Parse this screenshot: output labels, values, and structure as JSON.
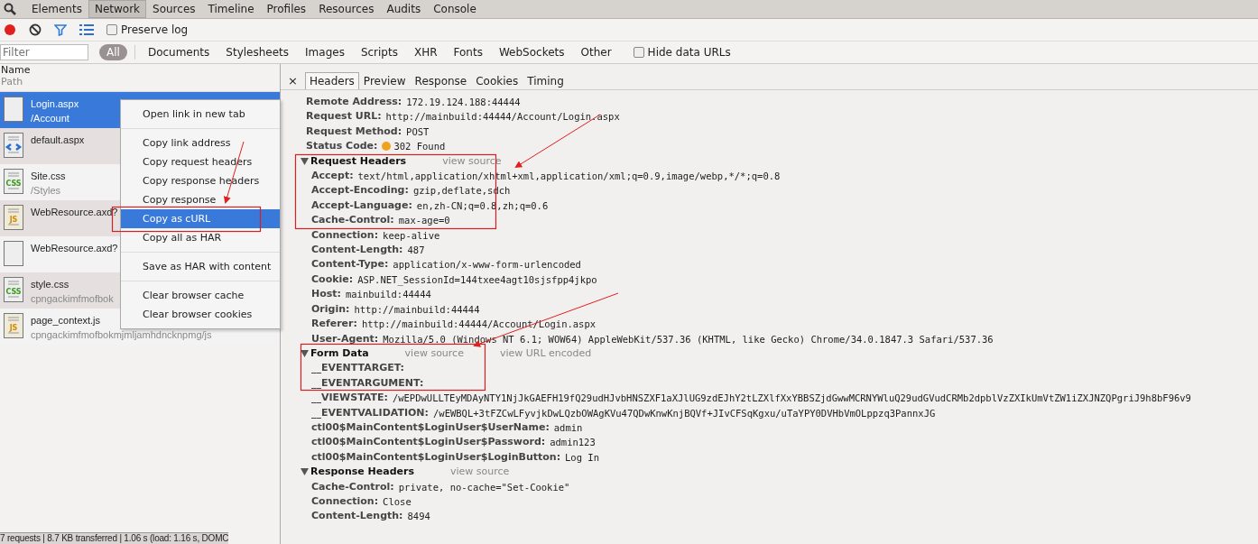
{
  "panel_tabs": [
    {
      "label": "Elements",
      "selected": false
    },
    {
      "label": "Network",
      "selected": true
    },
    {
      "label": "Sources",
      "selected": false
    },
    {
      "label": "Timeline",
      "selected": false
    },
    {
      "label": "Profiles",
      "selected": false
    },
    {
      "label": "Resources",
      "selected": false
    },
    {
      "label": "Audits",
      "selected": false
    },
    {
      "label": "Console",
      "selected": false
    }
  ],
  "toolbar": {
    "recording": true,
    "preserve_log": {
      "label": "Preserve log",
      "checked": false
    }
  },
  "filter_bar": {
    "placeholder": "Filter",
    "types": [
      {
        "label": "All",
        "selected": true
      },
      {
        "label": "Documents",
        "selected": false
      },
      {
        "label": "Stylesheets",
        "selected": false
      },
      {
        "label": "Images",
        "selected": false
      },
      {
        "label": "Scripts",
        "selected": false
      },
      {
        "label": "XHR",
        "selected": false
      },
      {
        "label": "Fonts",
        "selected": false
      },
      {
        "label": "WebSockets",
        "selected": false
      },
      {
        "label": "Other",
        "selected": false
      }
    ],
    "hide_data_urls": {
      "label": "Hide data URLs",
      "checked": false
    }
  },
  "request_list": {
    "columns": [
      "Name",
      "Path"
    ],
    "rows": [
      {
        "kind": "blank",
        "name": "Login.aspx",
        "path": "/Account",
        "selected": true
      },
      {
        "kind": "html",
        "name": "default.aspx",
        "selected": false
      },
      {
        "kind": "css",
        "icon_text": "CSS",
        "name": "Site.css",
        "path": "/Styles",
        "selected": false
      },
      {
        "kind": "js",
        "icon_text": "JS",
        "name": "WebResource.axd?",
        "selected": false
      },
      {
        "kind": "blank",
        "name": "WebResource.axd?",
        "selected": false
      },
      {
        "kind": "css",
        "icon_text": "CSS",
        "name": "style.css",
        "path": "cpngackimfmofbok",
        "selected": false
      },
      {
        "kind": "js",
        "icon_text": "JS",
        "name": "page_context.js",
        "path": "cpngackimfmofbokmjmljamhdncknpmg/js",
        "selected": false
      }
    ],
    "status_bar": "7 requests | 8.7 KB transferred | 1.06 s (load: 1.16 s, DOMC"
  },
  "context_menu": {
    "groups": [
      {
        "items": [
          {
            "label": "Open link in new tab",
            "selected": false
          }
        ]
      },
      {
        "items": [
          {
            "label": "Copy link address",
            "selected": false
          },
          {
            "label": "Copy request headers",
            "selected": false
          },
          {
            "label": "Copy response headers",
            "selected": false
          },
          {
            "label": "Copy response",
            "selected": false
          },
          {
            "label": "Copy as cURL",
            "selected": true
          },
          {
            "label": "Copy all as HAR",
            "selected": false
          }
        ]
      },
      {
        "items": [
          {
            "label": "Save as HAR with content",
            "selected": false
          }
        ]
      },
      {
        "items": [
          {
            "label": "Clear browser cache",
            "selected": false
          },
          {
            "label": "Clear browser cookies",
            "selected": false
          }
        ]
      }
    ]
  },
  "details": {
    "close": "×",
    "tabs": [
      {
        "label": "Headers",
        "selected": true
      },
      {
        "label": "Preview",
        "selected": false
      },
      {
        "label": "Response",
        "selected": false
      },
      {
        "label": "Cookies",
        "selected": false
      },
      {
        "label": "Timing",
        "selected": false
      }
    ],
    "general": [
      {
        "name": "Remote Address:",
        "value": "172.19.124.188:44444"
      },
      {
        "name": "Request URL:",
        "value": "http://mainbuild:44444/Account/Login.aspx"
      },
      {
        "name": "Request Method:",
        "value": "POST"
      },
      {
        "name": "Status Code:",
        "value": "302 Found",
        "color": "#f0a21e"
      }
    ],
    "sections": [
      {
        "title": "Request Headers",
        "expanded": true,
        "links": [
          "view source"
        ],
        "items": [
          {
            "name": "Accept:",
            "value": "text/html,application/xhtml+xml,application/xml;q=0.9,image/webp,*/*;q=0.8"
          },
          {
            "name": "Accept-Encoding:",
            "value": "gzip,deflate,sdch"
          },
          {
            "name": "Accept-Language:",
            "value": "en,zh-CN;q=0.8,zh;q=0.6"
          },
          {
            "name": "Cache-Control:",
            "value": "max-age=0"
          },
          {
            "name": "Connection:",
            "value": "keep-alive"
          },
          {
            "name": "Content-Length:",
            "value": "487"
          },
          {
            "name": "Content-Type:",
            "value": "application/x-www-form-urlencoded"
          },
          {
            "name": "Cookie:",
            "value": "ASP.NET_SessionId=144txee4agt10sjsfpp4jkpo"
          },
          {
            "name": "Host:",
            "value": "mainbuild:44444"
          },
          {
            "name": "Origin:",
            "value": "http://mainbuild:44444"
          },
          {
            "name": "Referer:",
            "value": "http://mainbuild:44444/Account/Login.aspx"
          },
          {
            "name": "User-Agent:",
            "value": "Mozilla/5.0 (Windows NT 6.1; WOW64) AppleWebKit/537.36 (KHTML, like Gecko) Chrome/34.0.1847.3 Safari/537.36"
          }
        ]
      },
      {
        "title": "Form Data",
        "expanded": true,
        "links": [
          "view source",
          "view URL encoded"
        ],
        "items": [
          {
            "name": "__EVENTTARGET:",
            "value": ""
          },
          {
            "name": "__EVENTARGUMENT:",
            "value": ""
          },
          {
            "name": "__VIEWSTATE:",
            "value": "/wEPDwULLTEyMDAyNTY1NjJkGAEFH19fQ29udHJvbHNSZXF1aXJlUG9zdEJhY2tLZXlfXxYBBSZjdGwwMCRNYWluQ29udGVudCRMb2dpblVzZXIkUmVtZW1iZXJNZQPgriJ9h8bF96v9"
          },
          {
            "name": "__EVENTVALIDATION:",
            "value": "/wEWBQL+3tFZCwLFyvjkDwLQzbOWAgKVu47QDwKnwKnjBQVf+JIvCFSqKgxu/uTaYPY0DVHbVmOLppzq3PannxJG"
          },
          {
            "name": "ctl00$MainContent$LoginUser$UserName:",
            "value": "admin"
          },
          {
            "name": "ctl00$MainContent$LoginUser$Password:",
            "value": "admin123"
          },
          {
            "name": "ctl00$MainContent$LoginUser$LoginButton:",
            "value": "Log In"
          }
        ]
      },
      {
        "title": "Response Headers",
        "expanded": true,
        "links": [
          "view source"
        ],
        "items": [
          {
            "name": "Cache-Control:",
            "value": "private, no-cache=\"Set-Cookie\""
          },
          {
            "name": "Connection:",
            "value": "Close"
          },
          {
            "name": "Content-Length:",
            "value": "8494"
          }
        ]
      }
    ]
  }
}
